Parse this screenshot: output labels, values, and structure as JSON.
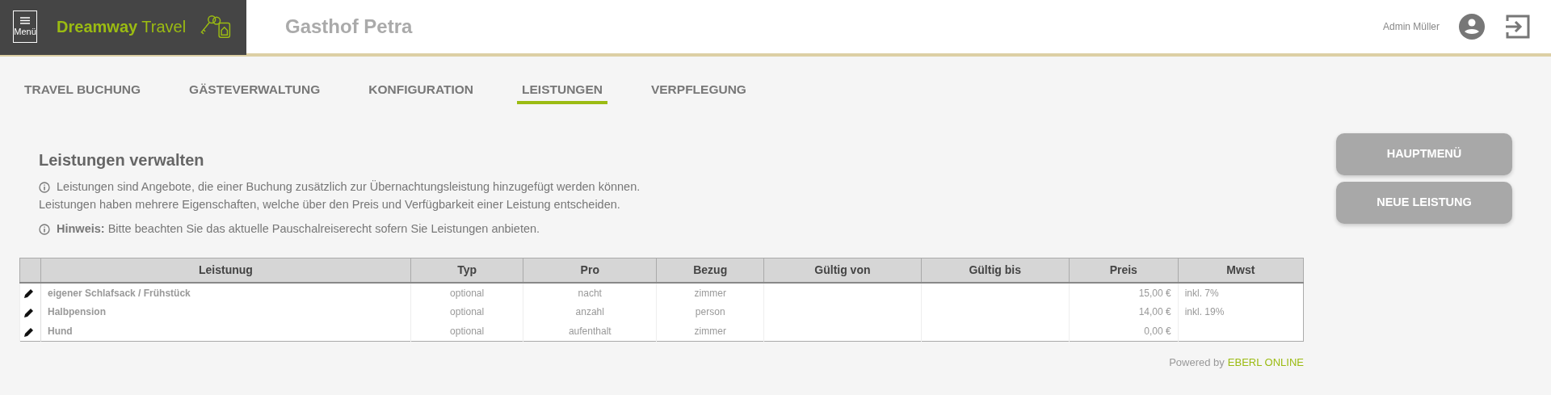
{
  "header": {
    "menu_label": "Menü",
    "brand_bold": "Dreamway",
    "brand_light": "Travel",
    "property_name": "Gasthof Petra",
    "user_name": "Admin Müller"
  },
  "tabs": [
    {
      "label": "TRAVEL BUCHUNG",
      "selected": false
    },
    {
      "label": "GÄSTEVERWALTUNG",
      "selected": false
    },
    {
      "label": "KONFIGURATION",
      "selected": false
    },
    {
      "label": "LEISTUNGEN",
      "selected": true
    },
    {
      "label": "VERPFLEGUNG",
      "selected": false
    }
  ],
  "title": "Leistungen verwalten",
  "info": [
    "Leistungen sind Angebote, die einer Buchung zusätzlich zur Übernachtungsleistung hinzugefügt werden können.",
    "Leistungen haben mehrere Eigenschaften, welche über den Preis und Verfügbarkeit einer Leistung entscheiden."
  ],
  "hint": "**Hinweis:** Bitte beachten Sie das aktuelle Pauschalreiserecht sofern Sie Leistungen anbieten.",
  "table": {
    "columns": [
      "Leistunug",
      "Typ",
      "Pro",
      "Bezug",
      "Gültig von",
      "Gültig bis",
      "Preis",
      "Mwst"
    ],
    "rows": [
      [
        "eigener Schlafsack / Frühstück",
        "optional",
        "nacht",
        "zimmer",
        "",
        "",
        "15,00 €",
        "inkl. 7%"
      ],
      [
        "Halbpension",
        "optional",
        "anzahl",
        "person",
        "",
        "",
        "14,00 €",
        "inkl. 19%"
      ],
      [
        "Hund",
        "optional",
        "aufenthalt",
        "zimmer",
        "",
        "",
        "0,00 €",
        ""
      ]
    ]
  },
  "buttons": [
    "HAUPTMENÜ",
    "NEUE LEISTUNG"
  ],
  "footer": {
    "prefix": "Powered by",
    "brand": "EBERL ONLINE"
  }
}
